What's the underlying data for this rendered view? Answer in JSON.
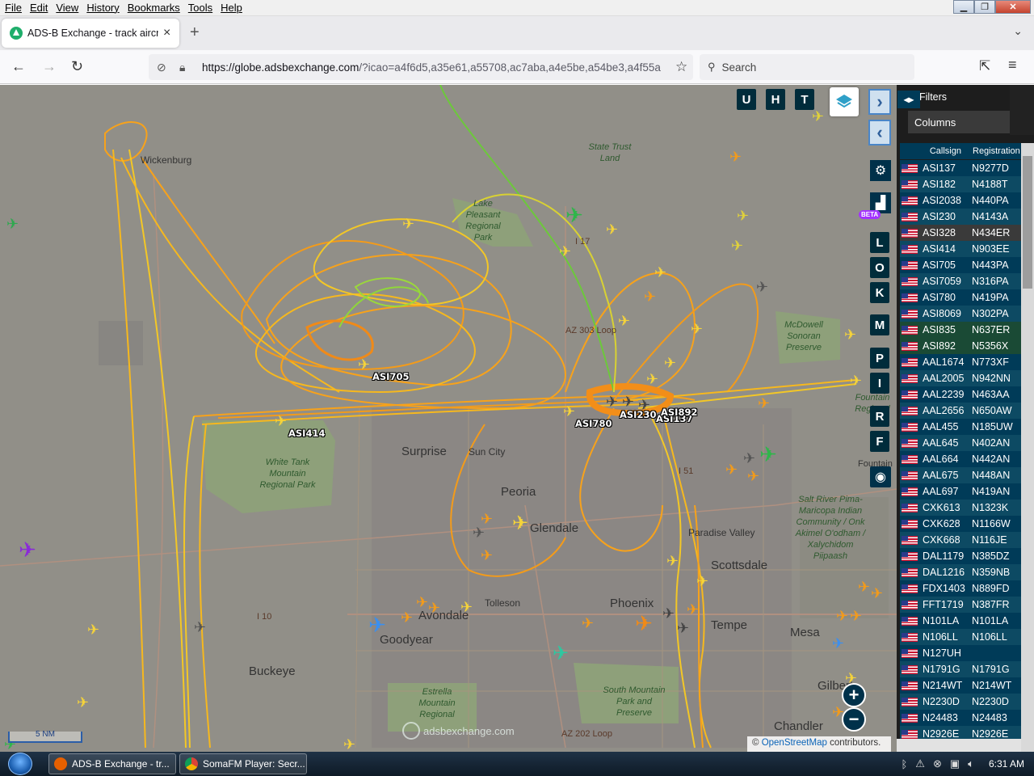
{
  "menubar": {
    "items": [
      "File",
      "Edit",
      "View",
      "History",
      "Bookmarks",
      "Tools",
      "Help"
    ]
  },
  "tab": {
    "title": "ADS-B Exchange - track aircraft",
    "close": "×",
    "new_tab": "+"
  },
  "navbar": {
    "url_host": "https://globe.adsbexchange.com",
    "url_rest": "/?icao=a4f6d5,a35e61,a55708,ac7aba,a4e5be,a54be3,a4f55a",
    "search_placeholder": "Search"
  },
  "map_controls": {
    "top_buttons": [
      "U",
      "H",
      "T"
    ],
    "side_buttons": [
      "L",
      "O",
      "K",
      "M",
      "P",
      "I",
      "R",
      "F"
    ],
    "beta": "BETA",
    "zoom_in": "+",
    "zoom_out": "−"
  },
  "map": {
    "places": [
      {
        "name": "Wickenburg",
        "size": "md"
      },
      {
        "name": "Surprise",
        "size": "lg"
      },
      {
        "name": "Sun City",
        "size": "md"
      },
      {
        "name": "Peoria",
        "size": "lg"
      },
      {
        "name": "Glendale",
        "size": "lg"
      },
      {
        "name": "Tolleson",
        "size": "md"
      },
      {
        "name": "Goodyear",
        "size": "lg"
      },
      {
        "name": "Buckeye",
        "size": "lg"
      },
      {
        "name": "Phoenix",
        "size": "lg"
      },
      {
        "name": "Tempe",
        "size": "lg"
      },
      {
        "name": "Scottsdale",
        "size": "lg"
      },
      {
        "name": "Mesa",
        "size": "lg"
      },
      {
        "name": "Paradise Valley",
        "size": "md"
      },
      {
        "name": "Chandler",
        "size": "lg"
      },
      {
        "name": "Gilbert",
        "size": "lg"
      },
      {
        "name": "Fountain",
        "size": "md"
      },
      {
        "name": "Avondale",
        "size": "lg"
      }
    ],
    "parks": [
      "State Trust Land",
      "Lake Pleasant Regional Park",
      "White Tank Mountain Regional Park",
      "McDowell Sonoran Preserve",
      "South Mountain Park and Preserve",
      "Estrella Mountain Regional",
      "Salt River Pima-Maricopa Indian Community / Onk Akimel O'odham / Xalychidom Piipaash",
      "Fountain Regional"
    ],
    "roads": [
      "I 17",
      "AZ 303 Loop",
      "I 10",
      "AZ 202 Loop",
      "I 51"
    ],
    "aircraft_labels": [
      "ASI705",
      "ASI414",
      "ASI780",
      "ASI230",
      "ASI137",
      "ASI892"
    ],
    "scale": "5 NM",
    "attribution_prefix": "©",
    "attribution_link": "OpenStreetMap",
    "attribution_suffix": " contributors.",
    "watermark": "adsbexchange.com"
  },
  "panel": {
    "filters": "Filters",
    "columns": "Columns",
    "headers": {
      "callsign": "Callsign",
      "registration": "Registration"
    },
    "rows": [
      {
        "callsign": "ASI137",
        "registration": "N9277D"
      },
      {
        "callsign": "ASI182",
        "registration": "N4188T"
      },
      {
        "callsign": "ASI2038",
        "registration": "N440PA"
      },
      {
        "callsign": "ASI230",
        "registration": "N4143A"
      },
      {
        "callsign": "ASI328",
        "registration": "N434ER"
      },
      {
        "callsign": "ASI414",
        "registration": "N903EE"
      },
      {
        "callsign": "ASI705",
        "registration": "N443PA"
      },
      {
        "callsign": "ASI7059",
        "registration": "N316PA"
      },
      {
        "callsign": "ASI780",
        "registration": "N419PA"
      },
      {
        "callsign": "ASI8069",
        "registration": "N302PA"
      },
      {
        "callsign": "ASI835",
        "registration": "N637ER"
      },
      {
        "callsign": "ASI892",
        "registration": "N5356X"
      },
      {
        "callsign": "AAL1674",
        "registration": "N773XF"
      },
      {
        "callsign": "AAL2005",
        "registration": "N942NN"
      },
      {
        "callsign": "AAL2239",
        "registration": "N463AA"
      },
      {
        "callsign": "AAL2656",
        "registration": "N650AW"
      },
      {
        "callsign": "AAL455",
        "registration": "N185UW"
      },
      {
        "callsign": "AAL645",
        "registration": "N402AN"
      },
      {
        "callsign": "AAL664",
        "registration": "N442AN"
      },
      {
        "callsign": "AAL675",
        "registration": "N448AN"
      },
      {
        "callsign": "AAL697",
        "registration": "N419AN"
      },
      {
        "callsign": "CXK613",
        "registration": "N1323K"
      },
      {
        "callsign": "CXK628",
        "registration": "N1166W"
      },
      {
        "callsign": "CXK668",
        "registration": "N116JE"
      },
      {
        "callsign": "DAL1179",
        "registration": "N385DZ"
      },
      {
        "callsign": "DAL1216",
        "registration": "N359NB"
      },
      {
        "callsign": "FDX1403",
        "registration": "N889FD"
      },
      {
        "callsign": "FFT1719",
        "registration": "N387FR"
      },
      {
        "callsign": "N101LA",
        "registration": "N101LA"
      },
      {
        "callsign": "N106LL",
        "registration": "N106LL"
      },
      {
        "callsign": "N127UH",
        "registration": ""
      },
      {
        "callsign": "N1791G",
        "registration": "N1791G"
      },
      {
        "callsign": "N214WT",
        "registration": "N214WT"
      },
      {
        "callsign": "N2230D",
        "registration": "N2230D"
      },
      {
        "callsign": "N24483",
        "registration": "N24483"
      },
      {
        "callsign": "N2926E",
        "registration": "N2926E"
      }
    ]
  },
  "taskbar": {
    "items": [
      {
        "label": "ADS-B Exchange - tr...",
        "icon": "firefox-icon",
        "color": "#e66000"
      },
      {
        "label": "SomaFM Player: Secr...",
        "icon": "chrome-icon",
        "color": "#3b8a3e"
      }
    ],
    "clock": "6:31 AM"
  }
}
